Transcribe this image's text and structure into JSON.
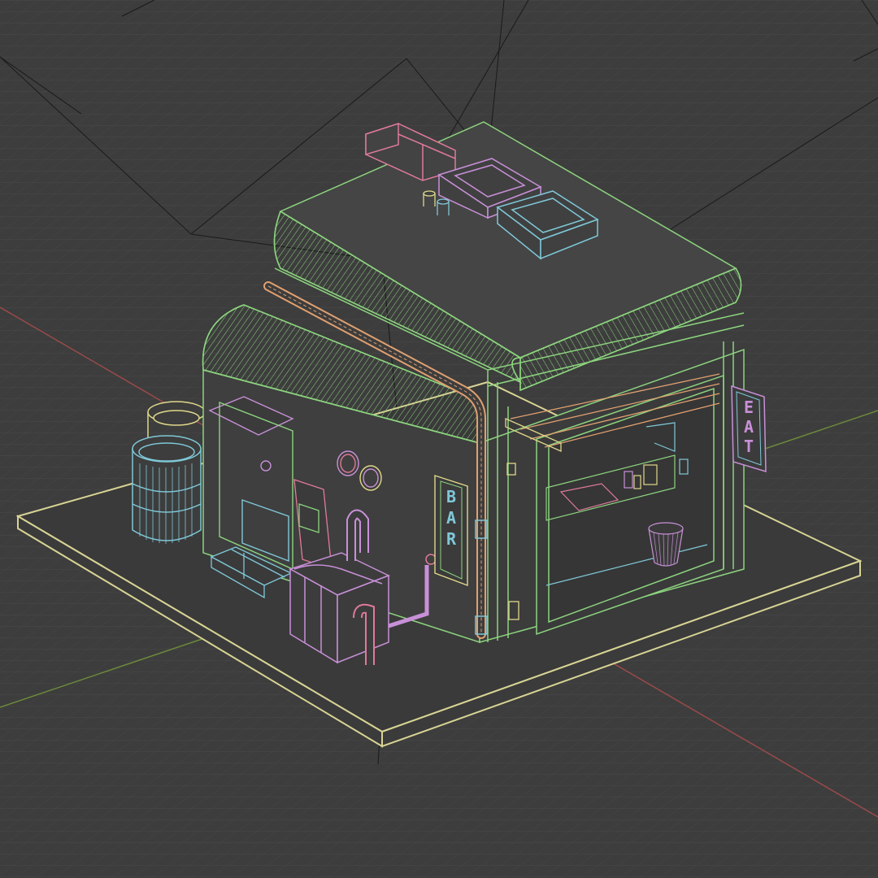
{
  "viewport": {
    "background": "#3d3d3d",
    "grid_color": "#4a4a4a",
    "x_axis_color": "#9a4a4a",
    "y_axis_color": "#6b8a3a",
    "camera_line_color": "#1a1a1a"
  },
  "objects": {
    "ground_plate": {
      "wire_color": "#d8d494"
    },
    "building": {
      "wire_color": "#8cd47e"
    },
    "roof_vents": {
      "wire_color": "#c890d8"
    },
    "duct": {
      "wire_color": "#e07a9a"
    },
    "drain_pipe": {
      "wire_color": "#e0a070"
    },
    "barrel_front": {
      "wire_color": "#7fc8d8"
    },
    "barrel_back": {
      "wire_color": "#e0d88a"
    },
    "steps": {
      "wire_color": "#7fc8d8"
    },
    "generator": {
      "wire_color": "#c890d8"
    },
    "trash_bin": {
      "wire_color": "#c890d8"
    },
    "awning": {
      "wire_color": "#e0a070"
    }
  },
  "signs": {
    "bar": {
      "text": "BAR",
      "color": "#7fc8d8"
    },
    "eat": {
      "text": "EAT",
      "color": "#c890d8"
    }
  }
}
